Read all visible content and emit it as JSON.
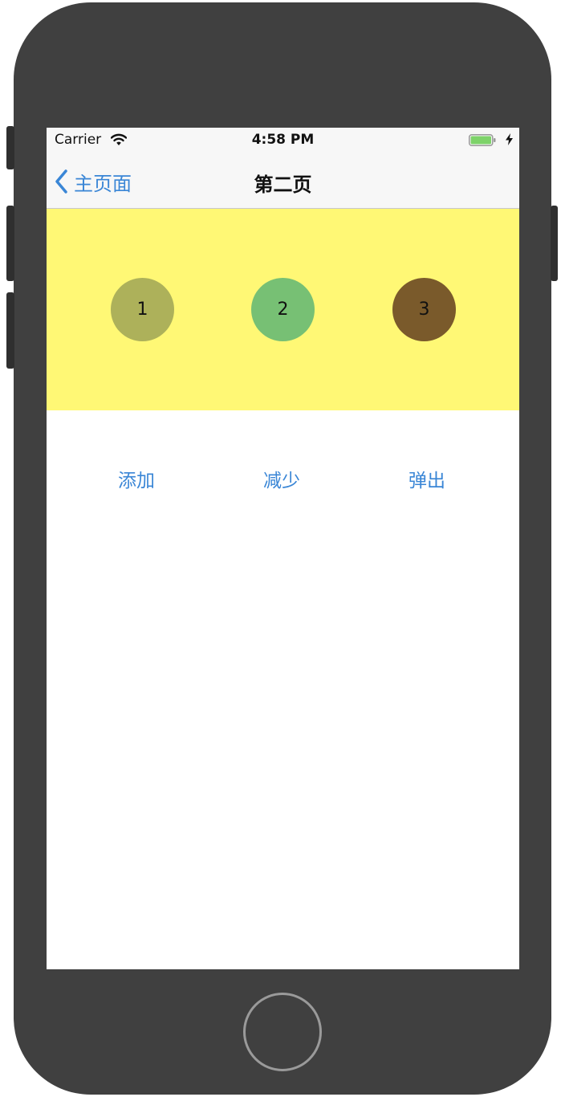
{
  "status_bar": {
    "carrier": "Carrier",
    "time": "4:58 PM",
    "wifi_icon": "wifi-icon",
    "battery_icon": "battery-icon",
    "charging_icon": "charging-bolt-icon"
  },
  "nav": {
    "back_label": "主页面",
    "back_icon": "chevron-left-icon",
    "title": "第二页"
  },
  "circles": [
    {
      "label": "1",
      "color": "#adb15a"
    },
    {
      "label": "2",
      "color": "#77c074"
    },
    {
      "label": "3",
      "color": "#7a5a2b"
    }
  ],
  "panel_color": "#fff875",
  "actions": {
    "add_label": "添加",
    "reduce_label": "减少",
    "popup_label": "弹出"
  },
  "accent_color": "#3a86d6"
}
